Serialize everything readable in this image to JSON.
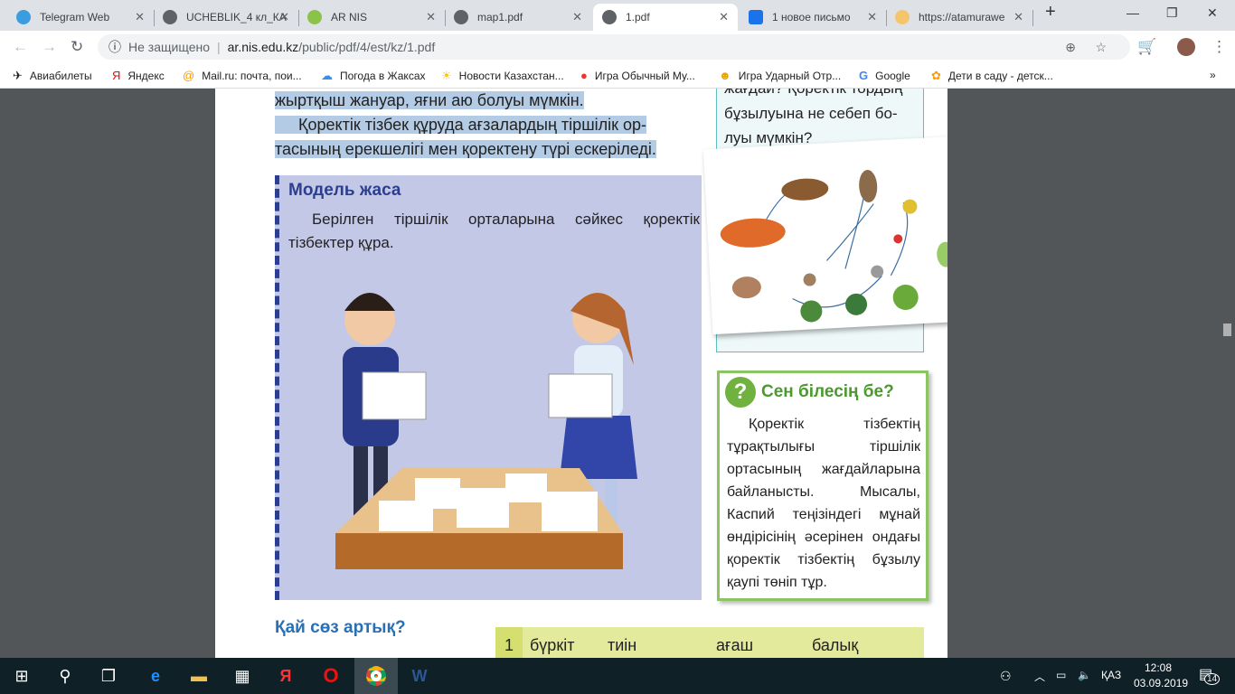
{
  "tabs": [
    {
      "label": "Telegram Web",
      "color": "#3a9de0"
    },
    {
      "label": "UCHEBLIK_4 кл_КА",
      "color": "#5f6368"
    },
    {
      "label": "AR NIS",
      "color": "#8bc34a"
    },
    {
      "label": "map1.pdf",
      "color": "#5f6368"
    },
    {
      "label": "1.pdf",
      "color": "#5f6368"
    },
    {
      "label": "1 новое письмо",
      "color": "#1a73e8"
    },
    {
      "label": "https://atamurawe",
      "color": "#f4c56b"
    }
  ],
  "address": {
    "security": "Не защищено",
    "host": "ar.nis.edu.kz",
    "path": "/public/pdf/4/est/kz/1.pdf"
  },
  "bookmarks": [
    {
      "label": "Авиабилеты",
      "icon": "✈"
    },
    {
      "label": "Яндекс",
      "icon": "Я"
    },
    {
      "label": "Mail.ru: почта, пои...",
      "icon": "@"
    },
    {
      "label": "Погода в Жаксах",
      "icon": "☁"
    },
    {
      "label": "Новости Казахстан...",
      "icon": "☀"
    },
    {
      "label": "Игра Обычный Му...",
      "icon": "●"
    },
    {
      "label": "Игра Ударный Отр...",
      "icon": "☻"
    },
    {
      "label": "Google",
      "icon": "G"
    },
    {
      "label": "Дети в саду - детск...",
      "icon": "✿"
    }
  ],
  "page": {
    "line1": "жыртқыш жануар, яғни аю болуы мүмкін.",
    "line2": "Қоректік тізбек құруда ағзалардың тіршілік ор-",
    "line3": "тасының ерекшелігі мен қоректену түрі ескеріледі.",
    "model_title": "Модель жаса",
    "model_text": "Берілген тіршілік орталарына сәйкес қоректік тізбектер құра.",
    "question_cut": "жағдай? Қоректік тордың",
    "question_l1": "бұзылуына не себеп бо-",
    "question_l2": "луы мүмкін?",
    "know_title": "Сен білесің бе?",
    "know_text": "Қоректік тізбектің тұрақтылығы тіршілік ортасының жағдайларына байланысты. Мысалы, Каспий теңізіндегі мұнай өндірісінің әсерінен ондағы қоректік тізбектің бұзылу қаупі төніп тұр.",
    "odd_title": "Қай сөз артық?",
    "row": {
      "num": "1",
      "words": [
        "бүркіт",
        "тиін",
        "ағаш",
        "балық"
      ]
    }
  },
  "tray": {
    "lang": "ҚАЗ",
    "time": "12:08",
    "date": "03.09.2019",
    "notifications": "14"
  }
}
